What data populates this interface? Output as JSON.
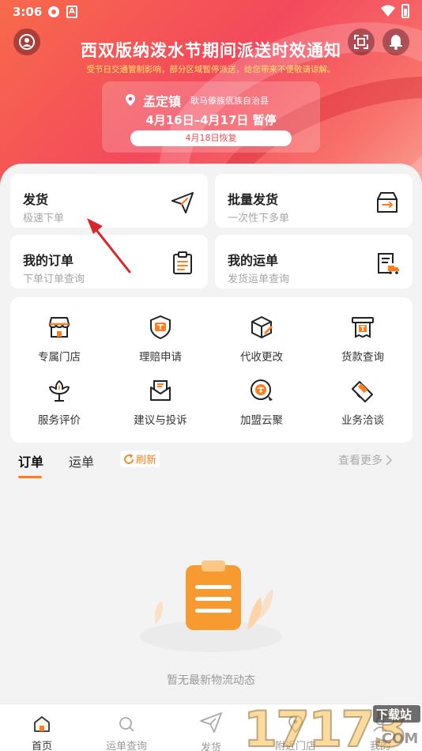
{
  "status_bar": {
    "time": "3:06",
    "a_badge": "A"
  },
  "banner": {
    "title": "西双版纳泼水节期间派送时效通知",
    "subtitle": "受节日交通管制影响，部分区域暂停派送，给您带来不便敬请谅解。",
    "town": "孟定镇",
    "county": "耿马傣族佤族自治县",
    "dates": "4月16日–4月17日 暂停",
    "resume": "4月18日恢复"
  },
  "quick_cards": {
    "ship": {
      "title": "发货",
      "subtitle": "极速下单"
    },
    "bulk": {
      "title": "批量发货",
      "subtitle": "一次性下多单"
    },
    "my_orders": {
      "title": "我的订单",
      "subtitle": "下单订单查询"
    },
    "my_waybills": {
      "title": "我的运单",
      "subtitle": "发货运单查询"
    }
  },
  "services": [
    {
      "label": "专属门店",
      "icon": "store-icon"
    },
    {
      "label": "理赔申请",
      "icon": "claim-shield-icon"
    },
    {
      "label": "代收更改",
      "icon": "package-edit-icon"
    },
    {
      "label": "货款查询",
      "icon": "payment-receipt-icon"
    },
    {
      "label": "服务评价",
      "icon": "flower-rating-icon"
    },
    {
      "label": "建议与投诉",
      "icon": "mail-feedback-icon"
    },
    {
      "label": "加盟云聚",
      "icon": "franchise-badge-icon"
    },
    {
      "label": "业务洽谈",
      "icon": "handshake-icon"
    }
  ],
  "tabs": {
    "orders": "订单",
    "waybills": "运单",
    "refresh": "刷新",
    "view_more": "查看更多"
  },
  "empty_state": {
    "text": "暂无最新物流动态"
  },
  "bottom_nav": [
    {
      "label": "首页",
      "icon": "home-icon",
      "active": true
    },
    {
      "label": "运单查询",
      "icon": "search-icon",
      "active": false
    },
    {
      "label": "发货",
      "icon": "send-icon",
      "active": false
    },
    {
      "label": "附近门店",
      "icon": "location-icon",
      "active": false
    },
    {
      "label": "我的",
      "icon": "user-icon",
      "active": false
    }
  ],
  "watermark": {
    "number": "17173",
    "site": "下载站",
    "domain": ".COM"
  },
  "colors": {
    "accent": "#ff7d1e",
    "banner_red": "#f3495c",
    "annotation_arrow": "#d9262b"
  }
}
